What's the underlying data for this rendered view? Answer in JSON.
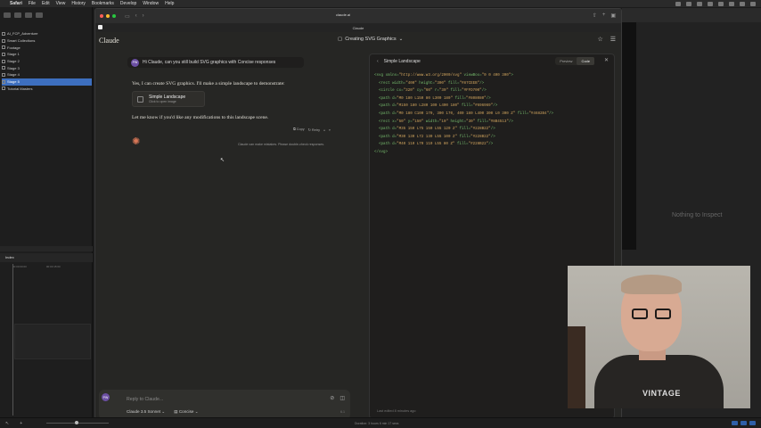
{
  "menubar": {
    "items": [
      "Safari",
      "File",
      "Edit",
      "View",
      "History",
      "Bookmarks",
      "Develop",
      "Window",
      "Help"
    ]
  },
  "library": {
    "items": [
      "AI_FCP_Adventure",
      "Smart Collections",
      "Footage",
      "Stage 1",
      "Stage 2",
      "Stage 3",
      "Stage 4",
      "Stage 5",
      "Tutorial Masters"
    ],
    "selected_index": 7
  },
  "timeline": {
    "index_label": "Index",
    "ticks": [
      "00:00:00:00",
      "00:00:15:00"
    ]
  },
  "status": {
    "duration": "Duration: 3 hours 6 min 17 secs"
  },
  "browser": {
    "url": "claude.ai",
    "tab_title": "Claude"
  },
  "app": {
    "brand": "Claude",
    "conversation_title": "Creating SVG Graphics"
  },
  "chat": {
    "user_initials": "PW",
    "user_message": "Hi Claude, can you still build SVG graphics with Concise responses",
    "reply_line1": "Yes, I can create SVG graphics. I'll make a simple landscape to demonstrate:",
    "artifact_title": "Simple Landscape",
    "artifact_subtitle": "Click to open image",
    "reply_line2": "Let me know if you'd like any modifications to this landscape scene.",
    "copy_label": "Copy",
    "retry_label": "Retry",
    "disclaimer": "Claude can make mistakes. Please double-check responses."
  },
  "composer": {
    "placeholder": "Reply to Claude...",
    "model": "Claude 3.5 Sonnet",
    "style": "Concise",
    "tokens": "6.1"
  },
  "artifact": {
    "title": "Simple Landscape",
    "tabs": [
      "Preview",
      "Code"
    ],
    "active_tab": "Code",
    "footer": "Last edited 8 minutes ago",
    "code_lines": [
      "<svg xmlns=\"http://www.w3.org/2000/svg\" viewBox=\"0 0 400 300\">",
      "  <rect width=\"400\" height=\"300\" fill=\"#87CEEB\"/>",
      "  <circle cx=\"320\" cy=\"60\" r=\"30\" fill=\"#FFD700\"/>",
      "  <path d=\"M0 180 L150 80 L300 180\" fill=\"#808080\"/>",
      "  <path d=\"M150 180 L280 100 L400 180\" fill=\"#696969\"/>",
      "  <path d=\"M0 180 C100 170, 300 170, 400 180 L400 300 L0 300 Z\" fill=\"#4682B4\"/>",
      "  <rect x=\"50\" y=\"150\" width=\"10\" height=\"30\" fill=\"#8B4513\"/>",
      "  <path d=\"M35 150 L75 150 L55 120 Z\" fill=\"#228B22\"/>",
      "  <path d=\"M30 130 L72 130 L55 100 Z\" fill=\"#228B22\"/>",
      "  <path d=\"M40 110 L70 110 L55 80 Z\" fill=\"#228B22\"/>",
      "</svg>"
    ]
  },
  "inspector": {
    "message": "Nothing to Inspect"
  },
  "webcam": {
    "shirt_text": "VINTAGE"
  }
}
